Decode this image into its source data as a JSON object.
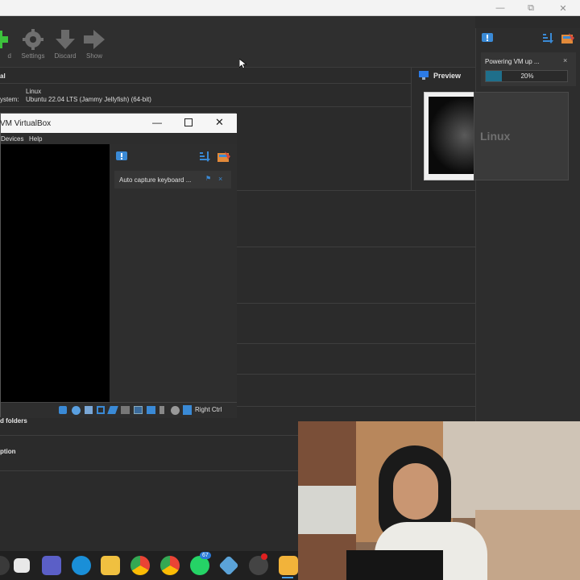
{
  "toolbar": {
    "items": [
      {
        "label": "d",
        "icon": "add-icon"
      },
      {
        "label": "Settings",
        "icon": "gear-icon"
      },
      {
        "label": "Discard",
        "icon": "arrow-down-icon"
      },
      {
        "label": "Show",
        "icon": "arrow-right-icon"
      }
    ]
  },
  "details": {
    "general_header": "al",
    "name_value": "Linux",
    "os_label": "ystem:",
    "os_value": "Ubuntu 22.04 LTS (Jammy Jellyfish) (64-bit)",
    "shared_folders": "d folders",
    "description": "ption"
  },
  "preview": {
    "header": "Preview",
    "screen_text": "Linux"
  },
  "notification": {
    "text": "Powering VM up ...",
    "progress_percent": 20,
    "progress_label": "20%",
    "accent": "#1f6f8b"
  },
  "vm_window": {
    "title": "VM VirtualBox",
    "menu": [
      "Devices",
      "Help"
    ],
    "notice_text": "Auto capture keyboard ...",
    "host_key": "Right Ctrl"
  },
  "taskbar": {
    "whatsapp_badge": "67"
  }
}
